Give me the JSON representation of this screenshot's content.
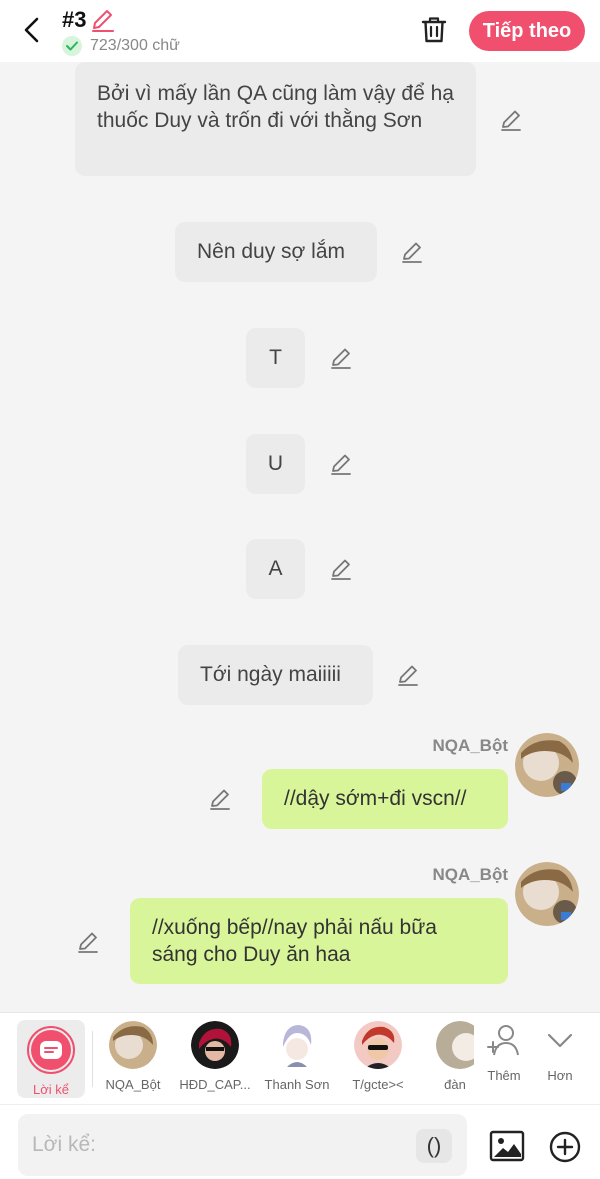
{
  "header": {
    "title": "#3",
    "word_count": "723/300 chữ",
    "next_label": "Tiếp theo"
  },
  "messages": [
    {
      "text": "Bởi vì mấy lần QA cũng làm vậy để hạ thuốc Duy và trốn đi với thằng Sơn"
    },
    {
      "text": "Nên duy sợ lắm"
    },
    {
      "text": "T"
    },
    {
      "text": "U"
    },
    {
      "text": "A"
    },
    {
      "text": "Tới ngày maiiiii"
    },
    {
      "sender": "NQA_Bột",
      "text": "//dậy sớm+đi vscn//"
    },
    {
      "sender": "NQA_Bột",
      "text": "//xuống bếp//nay phải nấu bữa sáng cho Duy ăn haa"
    }
  ],
  "characters": {
    "narrator": "Lời kể",
    "list": [
      "NQA_Bột",
      "HĐD_CAP...",
      "Thanh Sơn",
      "T/gcte><",
      "đàn"
    ]
  },
  "tools": {
    "add": "Thêm",
    "more": "Hơn"
  },
  "input": {
    "placeholder": "Lời kể:",
    "paren": "()"
  },
  "colors": {
    "accent": "#f0506e",
    "my_bubble": "#d9f59a",
    "narration_bubble": "#ebebeb"
  }
}
